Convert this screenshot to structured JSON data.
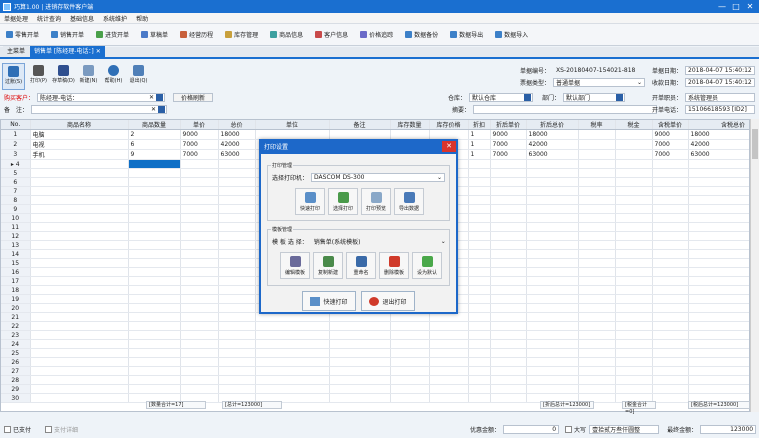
{
  "window": {
    "title": "巧算1.00 | 进销存软件客户端",
    "controls": [
      "—",
      "□",
      "✕"
    ]
  },
  "menu": [
    "单据处理",
    "统计查询",
    "基础信息",
    "系统维护",
    "帮助"
  ],
  "toolbar": [
    {
      "label": "零售开单",
      "color": "#3c80c8"
    },
    {
      "label": "销售开单",
      "color": "#3c80c8"
    },
    {
      "label": "进货开单",
      "color": "#4aa04a"
    },
    {
      "label": "草稿单",
      "color": "#4a7ac8"
    },
    {
      "label": "经营历程",
      "color": "#c8603c"
    },
    {
      "label": "库存管理",
      "color": "#c8a03c"
    },
    {
      "label": "商品信息",
      "color": "#3ca0a0"
    },
    {
      "label": "客户信息",
      "color": "#c84a4a"
    },
    {
      "label": "价格追踪",
      "color": "#6a6ac8"
    },
    {
      "label": "数据备份",
      "color": "#3c80c8"
    },
    {
      "label": "数据导出",
      "color": "#3c80c8"
    },
    {
      "label": "数据导入",
      "color": "#3c80c8"
    }
  ],
  "tabs": {
    "main": "主菜单",
    "active": "销售单 [陈经理-电话：]",
    "close": "✕"
  },
  "icontb": [
    {
      "label": "过账(S)",
      "color": "#2f6fb6"
    },
    {
      "label": "打印(P)",
      "color": "#555"
    },
    {
      "label": "存草稿(D)",
      "color": "#2f4f8f"
    },
    {
      "label": "新建(N)",
      "color": "#7a9ac0"
    },
    {
      "label": "帮助(H)",
      "color": "#2f6fb6"
    },
    {
      "label": "退出(Q)",
      "color": "#4f7fb8"
    }
  ],
  "header": {
    "customer_label": "购买客户：",
    "customer_value": "陈经理-电话：",
    "price_btn": "价格刷新",
    "remark_label": "备　注：",
    "warehouse_label": "仓库：",
    "warehouse_value": "默认仓库",
    "dept_label": "部门：",
    "dept_value": "默认部门",
    "summary_label": "摘要：",
    "docno_label": "单据编号：",
    "docno_value": "XS-20180407-154021-818",
    "doctype_label": "票据类型：",
    "doctype_value": "普通单据",
    "date1_label": "单据日期：",
    "date1_value": "2018-04-07 15:40:12",
    "date2_label": "收款日期：",
    "date2_value": "2018-04-07 15:40:12",
    "handler_label": "开单职员：",
    "handler_value": "系统管理员",
    "phone_label": "开单电话：",
    "phone_value": "15106618593 [ID2]",
    "clear": "✕"
  },
  "grid": {
    "columns": [
      "No.",
      "商品名称",
      "商品数量",
      "单价",
      "总价",
      "单位",
      "备注",
      "库存数量",
      "库存价格",
      "折扣",
      "折后单价",
      "折后总价",
      "税率",
      "税金",
      "含税单价",
      "含税总价"
    ],
    "rows": [
      [
        "1",
        "电脑",
        "2",
        "9000",
        "18000",
        "",
        "",
        "",
        "",
        "1",
        "9000",
        "18000",
        "",
        "",
        "9000",
        "18000"
      ],
      [
        "2",
        "电视",
        "6",
        "7000",
        "42000",
        "",
        "",
        "",
        "",
        "1",
        "7000",
        "42000",
        "",
        "",
        "7000",
        "42000"
      ],
      [
        "3",
        "手机",
        "9",
        "7000",
        "63000",
        "",
        "",
        "",
        "",
        "1",
        "7000",
        "63000",
        "",
        "",
        "7000",
        "63000"
      ],
      [
        "4",
        "",
        "",
        "",
        "",
        "",
        "",
        "",
        "",
        "",
        "",
        "",
        "",
        "",
        "",
        ""
      ]
    ],
    "empty_row_numbers": [
      "5",
      "6",
      "7",
      "8",
      "9",
      "10",
      "11",
      "12",
      "13",
      "14",
      "15",
      "16",
      "17",
      "18",
      "19",
      "20",
      "21",
      "22",
      "23",
      "24",
      "25",
      "26",
      "27",
      "28",
      "29",
      "30"
    ]
  },
  "sums": {
    "qty": "[数量合计=17]",
    "total": "[总计=123000]",
    "after": "[折后总计=123000]",
    "tax": "[税金合计=0]",
    "taxtotal": "[税后总计=123000]"
  },
  "footer": {
    "paid_label": "已支付",
    "pay_detail": "支付详细",
    "discount_label": "优惠金额：",
    "discount_value": "0",
    "upper_label": "大写",
    "upper_value": "壹拾贰万叁仟圆整",
    "final_label": "最终金额：",
    "final_value": "123000"
  },
  "dialog": {
    "title": "打印设置",
    "print_group": "打印管理",
    "printer_label": "选择打印机：",
    "printer_value": "DASCOM DS-300",
    "print_btns": [
      "快速打印",
      "选择打印",
      "打印预览",
      "导出数据"
    ],
    "template_group": "模板管理",
    "template_label": "模 板 选 择：",
    "template_value": "销售单(系统模板)",
    "template_btns": [
      "编辑模板",
      "复制新建",
      "重命名",
      "删除模板",
      "设为默认"
    ],
    "quick_print": "快速打印",
    "exit_print": "退出打印"
  }
}
